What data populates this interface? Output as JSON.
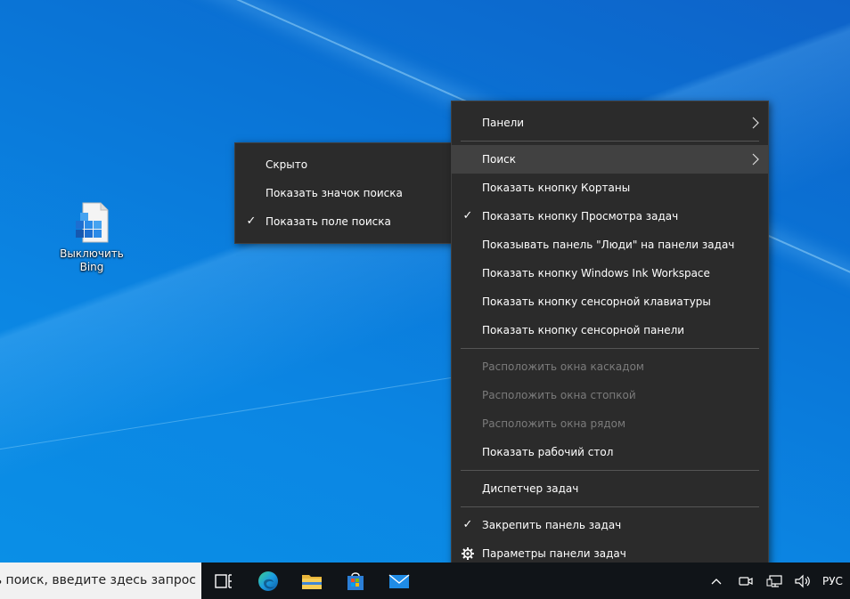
{
  "desktop": {
    "icon_label": "Выключить Bing"
  },
  "main_menu": {
    "items": [
      {
        "label": "Панели",
        "submenu": true
      },
      {
        "label": "Поиск",
        "submenu": true,
        "highlighted": true
      },
      {
        "label": "Показать кнопку Кортаны"
      },
      {
        "label": "Показать кнопку Просмотра задач",
        "checked": true
      },
      {
        "label": "Показывать панель \"Люди\" на панели задач"
      },
      {
        "label": "Показать кнопку Windows Ink Workspace"
      },
      {
        "label": "Показать кнопку сенсорной клавиатуры"
      },
      {
        "label": "Показать кнопку сенсорной панели"
      },
      {
        "label": "Расположить окна каскадом",
        "disabled": true
      },
      {
        "label": "Расположить окна стопкой",
        "disabled": true
      },
      {
        "label": "Расположить окна рядом",
        "disabled": true
      },
      {
        "label": "Показать рабочий стол"
      },
      {
        "label": "Диспетчер задач"
      },
      {
        "label": "Закрепить панель задач",
        "checked": true
      },
      {
        "label": "Параметры панели задач",
        "icon": "gear-icon"
      }
    ]
  },
  "sub_menu": {
    "items": [
      {
        "label": "Скрыто"
      },
      {
        "label": "Показать значок поиска"
      },
      {
        "label": "Показать поле поиска",
        "checked": true
      }
    ]
  },
  "taskbar": {
    "search_text": "ать поиск, введите здесь запрос",
    "apps": [
      "task-view-icon",
      "edge-icon",
      "file-explorer-icon",
      "store-icon",
      "mail-icon"
    ],
    "tray": {
      "language": "РУС"
    }
  },
  "colors": {
    "menu_bg": "#2b2b2b",
    "menu_hover": "#414141",
    "disabled_text": "#7b7b7b",
    "taskbar_bg": "#101418",
    "desktop_blue": "#0a78d7"
  }
}
